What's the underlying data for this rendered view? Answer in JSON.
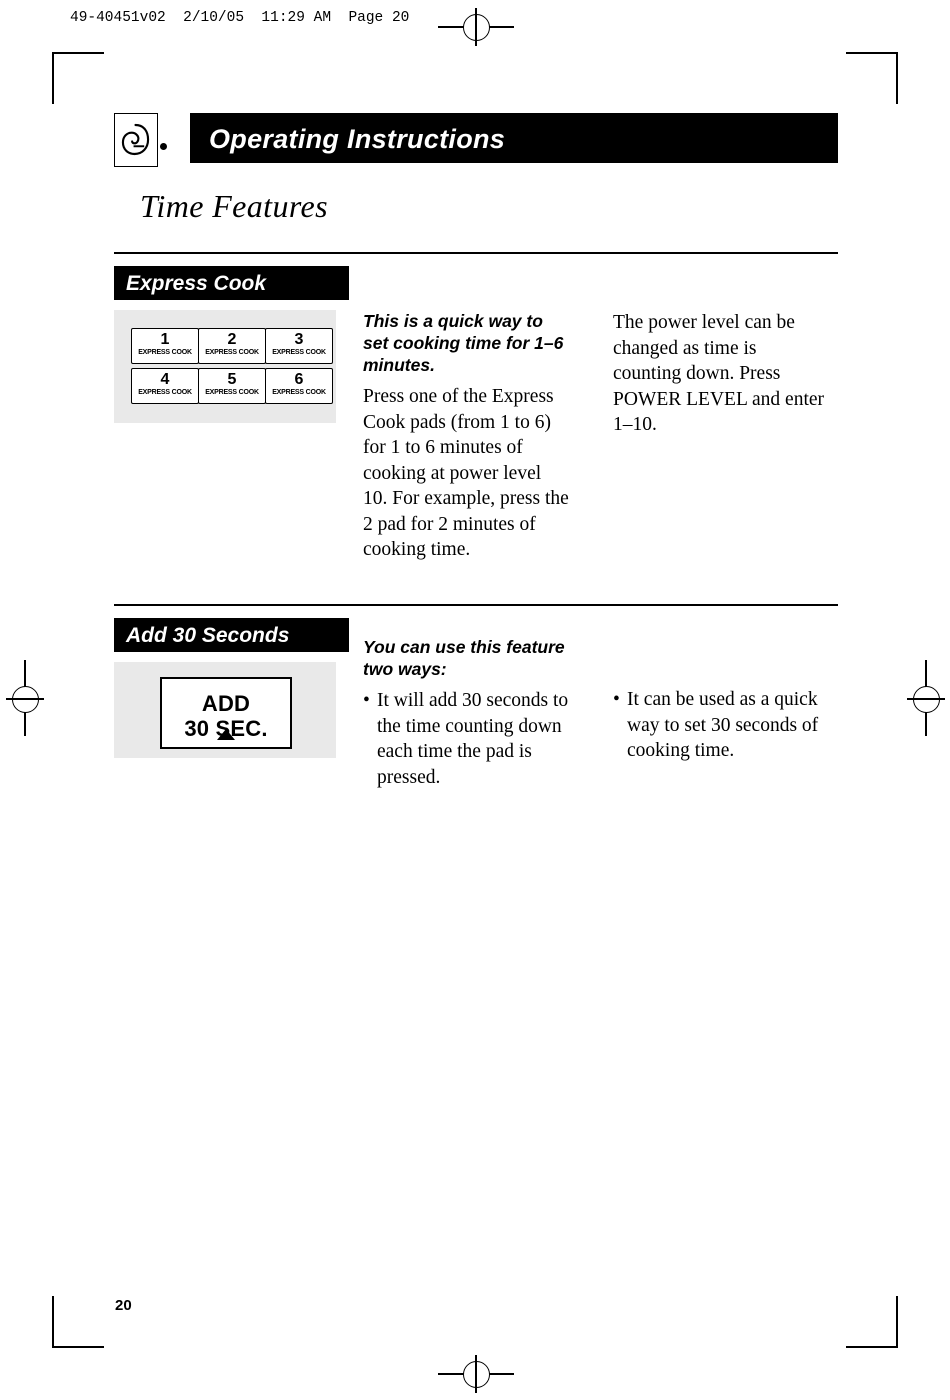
{
  "print_marks": {
    "file_info": "49-40451v02  2/10/05  11:29 AM  Page 20"
  },
  "header": {
    "logo_icon": "ge-swirl-logo",
    "banner_title": "Operating Instructions"
  },
  "page_title": "Time Features",
  "folio": "20",
  "sections": [
    {
      "label": "Express Cook",
      "keypad": {
        "keys": [
          {
            "number": "1",
            "caption": "EXPRESS COOK"
          },
          {
            "number": "2",
            "caption": "EXPRESS COOK"
          },
          {
            "number": "3",
            "caption": "EXPRESS COOK"
          },
          {
            "number": "4",
            "caption": "EXPRESS COOK"
          },
          {
            "number": "5",
            "caption": "EXPRESS COOK"
          },
          {
            "number": "6",
            "caption": "EXPRESS COOK"
          }
        ]
      },
      "column_1": {
        "lead": "This is a quick way to set cooking time for 1–6 minutes.",
        "body": "Press one of the Express Cook pads (from 1 to 6) for 1 to 6 minutes of cooking at power level 10. For example, press the 2 pad for 2 minutes of cooking time."
      },
      "column_2": {
        "body": "The power level can be changed as time is counting down. Press POWER LEVEL and enter 1–10."
      }
    },
    {
      "label": "Add 30 Seconds",
      "pad": {
        "line_1": "ADD",
        "line_2": "30 SEC.",
        "arrow_icon": "triangle-up-icon"
      },
      "column_1": {
        "lead": "You can use this feature two ways:",
        "bullet": "It will add 30 seconds to the time counting down each time the pad is pressed.",
        "bullet_marker": "•"
      },
      "column_2": {
        "bullet": "It can be used as a quick way to set 30 seconds of cooking time.",
        "bullet_marker": "•"
      }
    }
  ]
}
